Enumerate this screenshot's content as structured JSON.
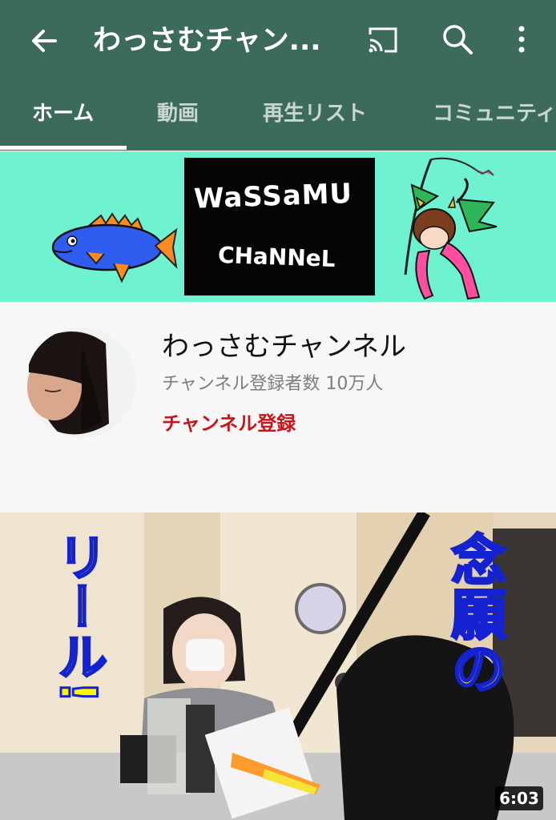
{
  "app": {
    "title": "わっさむチャン...",
    "nav_icons": [
      "arrow-left-icon",
      "cast-icon",
      "search-icon",
      "more-vertical-icon"
    ]
  },
  "tabs": [
    {
      "label": "ホーム",
      "active": true
    },
    {
      "label": "動画",
      "active": false
    },
    {
      "label": "再生リスト",
      "active": false
    },
    {
      "label": "コミュニティ",
      "active": false
    }
  ],
  "banner": {
    "logo_line1": "WaSSaMU",
    "logo_line2": "CHaNNeL"
  },
  "channel": {
    "name": "わっさむチャンネル",
    "subscribers": "チャンネル登録者数 10万人",
    "subscribe_label": "チャンネル登録"
  },
  "video": {
    "duration": "6:03",
    "thumb_text_left": "リール!",
    "thumb_text_right": "念願の"
  },
  "colors": {
    "appbar": "#3d6b5a",
    "banner_bg": "#6ef2cf",
    "subscribe": "#c4161c"
  }
}
